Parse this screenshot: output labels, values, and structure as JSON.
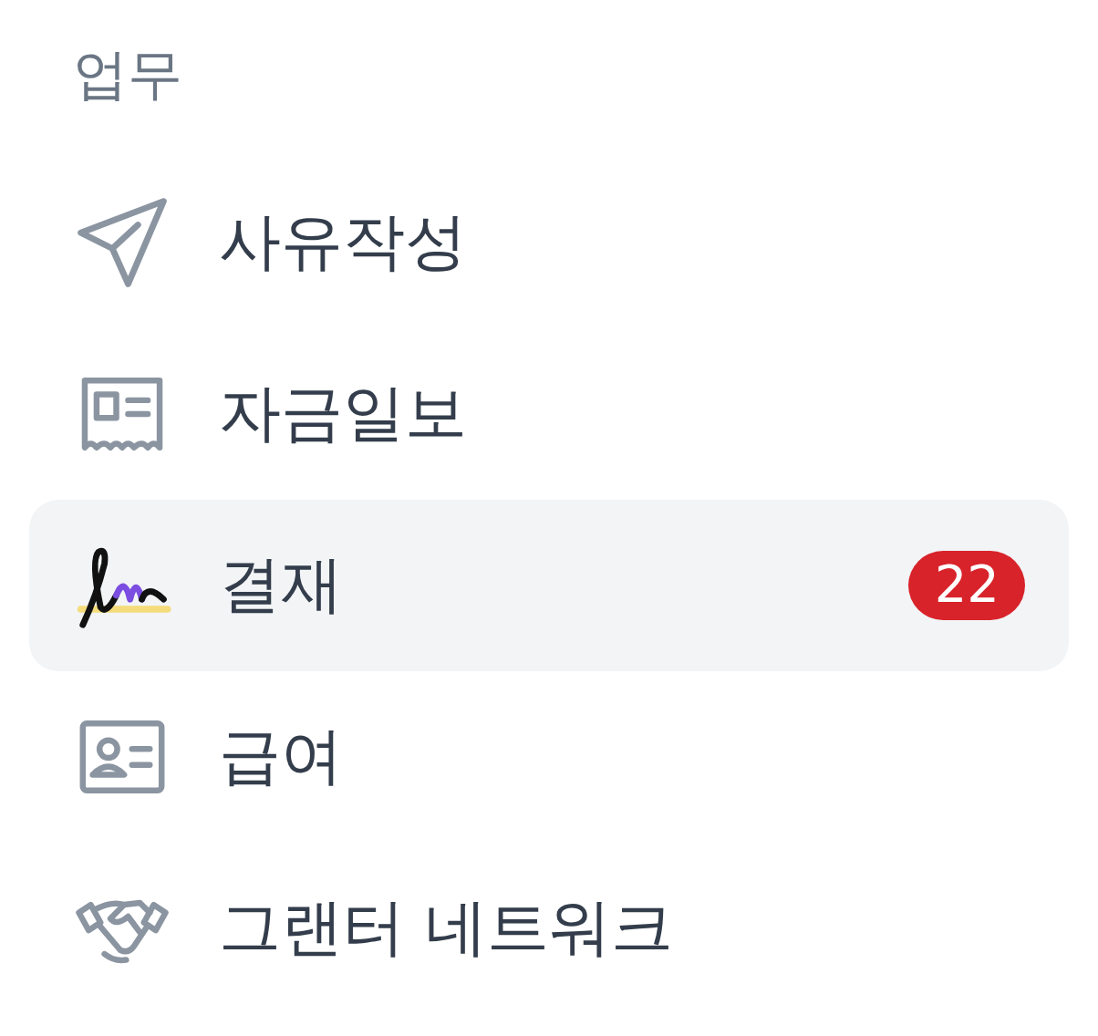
{
  "section": {
    "title": "업무"
  },
  "items": [
    {
      "label": "사유작성",
      "kind": "send",
      "selected": false
    },
    {
      "label": "자금일보",
      "kind": "receipt",
      "selected": false
    },
    {
      "label": "결재",
      "kind": "signature",
      "selected": true,
      "badge": "22"
    },
    {
      "label": "급여",
      "kind": "idcard",
      "selected": false
    },
    {
      "label": "그랜터 네트워크",
      "kind": "handshake",
      "selected": false
    }
  ]
}
